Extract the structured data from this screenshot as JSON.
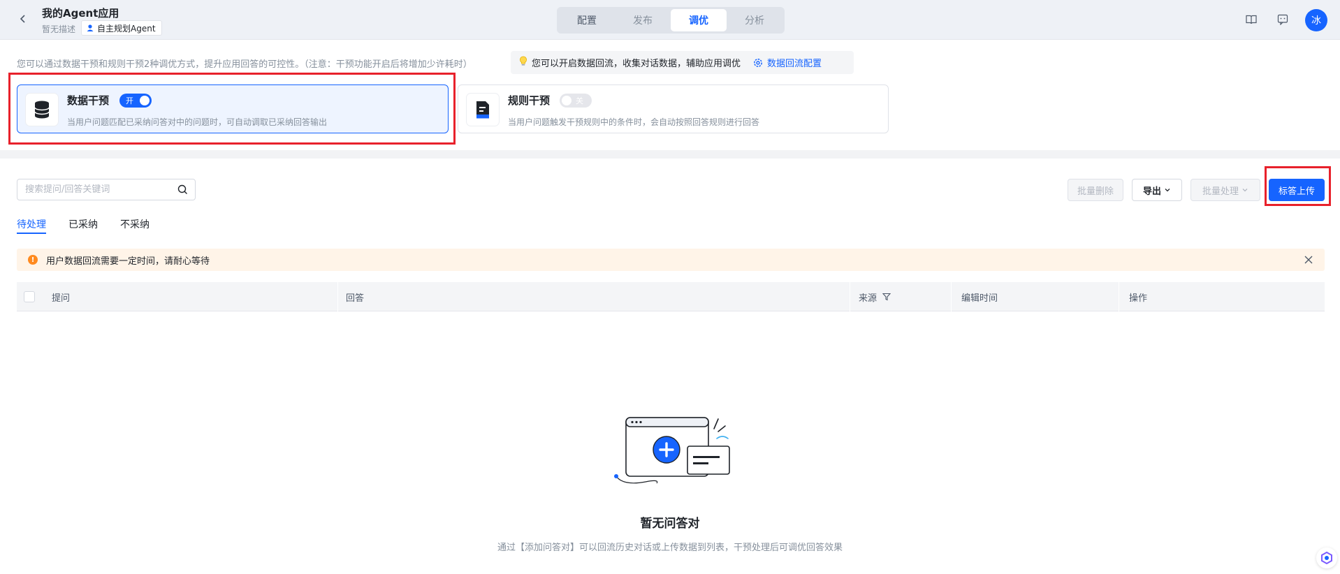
{
  "header": {
    "title": "我的Agent应用",
    "description": "暂无描述",
    "agent_tag": "自主规划Agent",
    "tabs": [
      {
        "label": "配置"
      },
      {
        "label": "发布"
      },
      {
        "label": "调优",
        "active": true
      },
      {
        "label": "分析"
      }
    ],
    "icons": [
      "book-icon",
      "feedback-icon"
    ],
    "avatar_text": "冰"
  },
  "intro": {
    "text": "您可以通过数据干预和规则干预2种调优方式，提升应用回答的可控性。（注意：干预功能开启后将增加少许耗时）",
    "tip": "您可以开启数据回流，收集对话数据，辅助应用调优",
    "tip_link": "数据回流配置"
  },
  "cards": [
    {
      "title": "数据干预",
      "toggle_label": "开",
      "enabled": true,
      "desc": "当用户问题匹配已采纳问答对中的问题时，可自动调取已采纳回答输出"
    },
    {
      "title": "规则干预",
      "toggle_label": "关",
      "enabled": false,
      "desc": "当用户问题触发干预规则中的条件时，会自动按照回答规则进行回答"
    }
  ],
  "toolbar": {
    "search_placeholder": "搜索提问/回答关键词",
    "batch_delete": "批量删除",
    "export": "导出",
    "batch_process": "批量处理",
    "upload": "标答上传"
  },
  "subtabs": [
    {
      "label": "待处理",
      "active": true
    },
    {
      "label": "已采纳"
    },
    {
      "label": "不采纳"
    }
  ],
  "alert": {
    "text": "用户数据回流需要一定时间，请耐心等待"
  },
  "table": {
    "columns": [
      "提问",
      "回答",
      "来源",
      "编辑时间",
      "操作"
    ]
  },
  "empty": {
    "title": "暂无问答对",
    "desc": "通过【添加问答对】可以回流历史对话或上传数据到列表，干预处理后可调优回答效果"
  },
  "colors": {
    "accent": "#1664ff",
    "highlight": "#e8212b",
    "alert_bg": "#fff4e8"
  }
}
